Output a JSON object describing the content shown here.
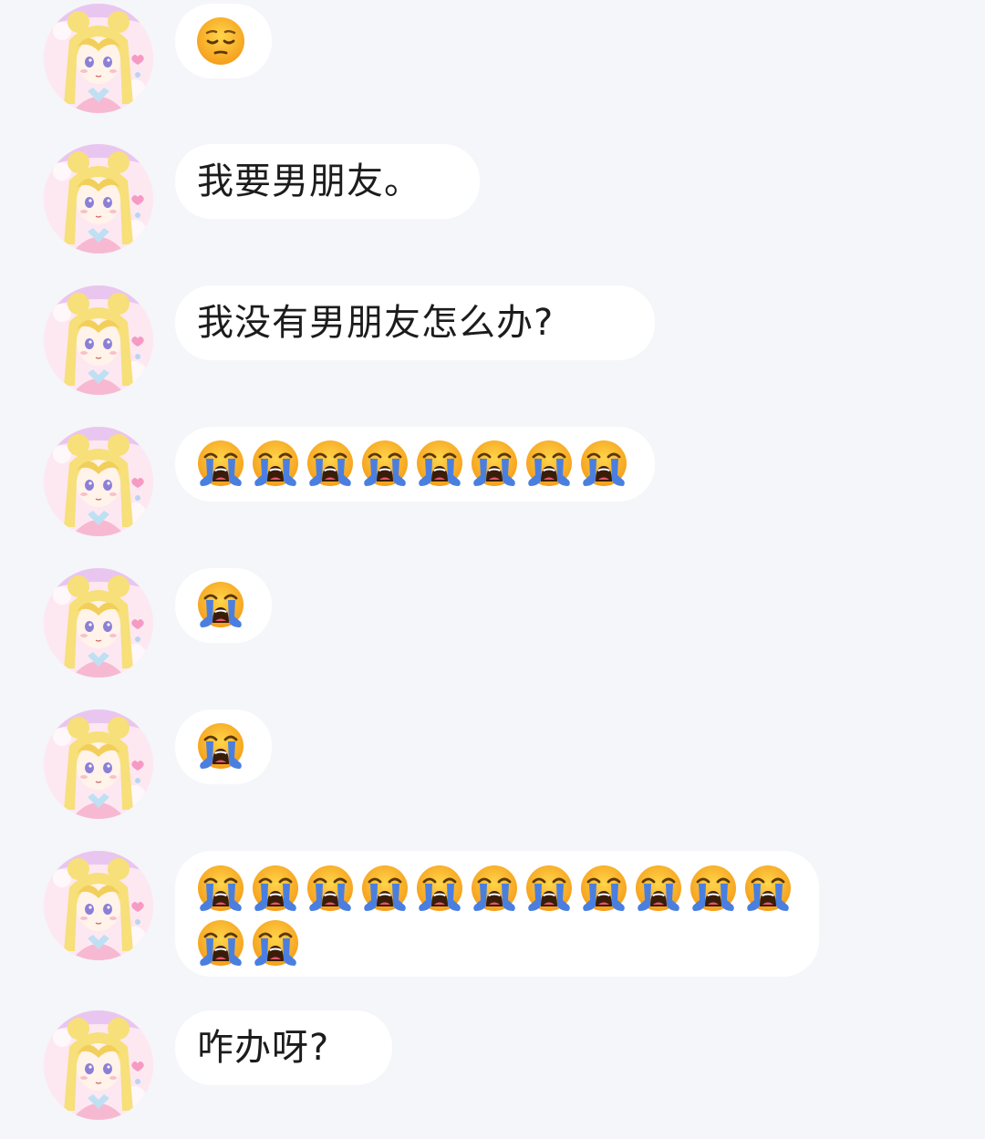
{
  "messages": [
    {
      "type": "emoji",
      "emojis": [
        "pensive"
      ]
    },
    {
      "type": "text",
      "text": "我要男朋友。"
    },
    {
      "type": "text",
      "text": "我没有男朋友怎么办?"
    },
    {
      "type": "emoji",
      "emojis": [
        "loudly-crying",
        "loudly-crying",
        "loudly-crying",
        "loudly-crying",
        "loudly-crying",
        "loudly-crying",
        "loudly-crying",
        "loudly-crying"
      ]
    },
    {
      "type": "emoji",
      "emojis": [
        "loudly-crying"
      ]
    },
    {
      "type": "emoji",
      "emojis": [
        "loudly-crying"
      ]
    },
    {
      "type": "emoji",
      "emojis": [
        "loudly-crying",
        "loudly-crying",
        "loudly-crying",
        "loudly-crying",
        "loudly-crying",
        "loudly-crying",
        "loudly-crying",
        "loudly-crying",
        "loudly-crying",
        "loudly-crying",
        "loudly-crying",
        "loudly-crying",
        "loudly-crying"
      ]
    },
    {
      "type": "text",
      "text": "咋办呀?"
    }
  ],
  "colors": {
    "background": "#f4f6f9",
    "bubble": "#ffffff",
    "text": "#1c1c1c",
    "avatar_bg": "#fbe4ee",
    "emoji_face": "#f7b43a",
    "tears": "#4a7fe0"
  },
  "avatar_icon": "sailor-moon-avatar-icon"
}
